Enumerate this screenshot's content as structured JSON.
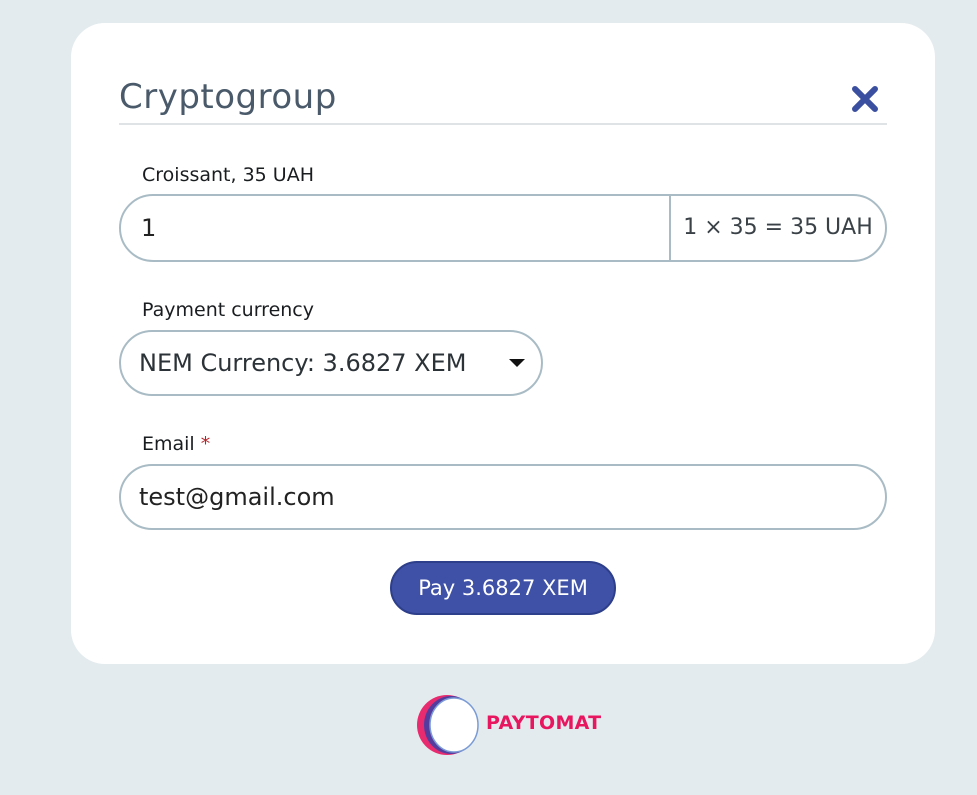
{
  "dialog": {
    "title": "Cryptogroup"
  },
  "product": {
    "label": "Croissant, 35 UAH",
    "quantity": "1",
    "total": "1 × 35 = 35 UAH"
  },
  "currency": {
    "label": "Payment currency",
    "selected": "NEM Currency: 3.6827 XEM"
  },
  "email": {
    "label": "Email",
    "required_mark": "*",
    "value": "test@gmail.com"
  },
  "pay_button": {
    "label": "Pay 3.6827 XEM"
  },
  "footer": {
    "logo_text": "PAYTOMAT"
  },
  "colors": {
    "accent": "#3f51a6",
    "close_icon": "#3a4fa0",
    "brand": "#e8165f",
    "background": "#e3ebee"
  }
}
